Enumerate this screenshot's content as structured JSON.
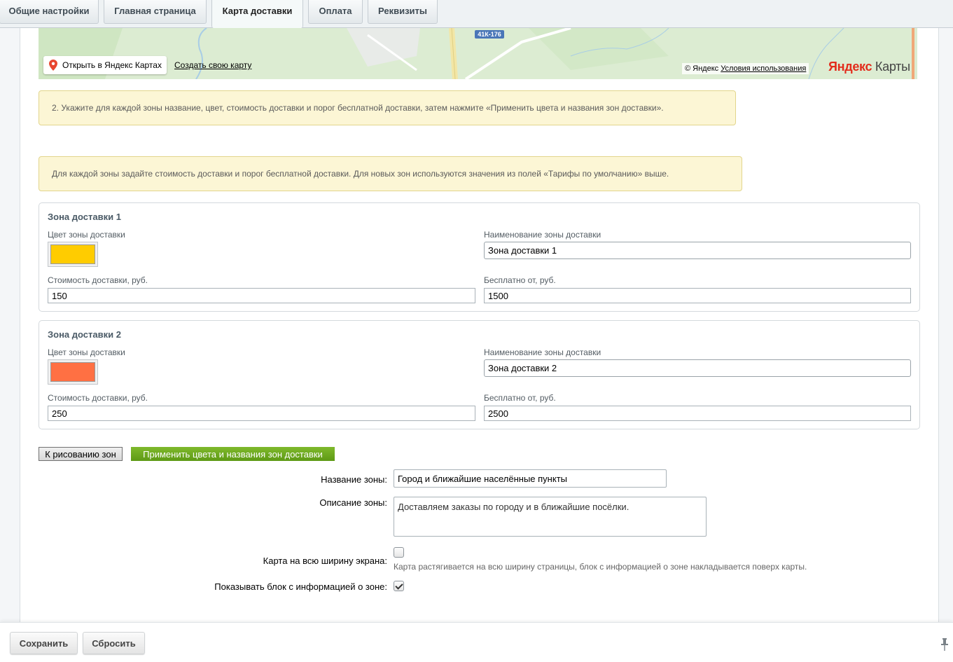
{
  "tabs": [
    {
      "label": "Общие настройки"
    },
    {
      "label": "Главная страница"
    },
    {
      "label": "Карта доставки"
    },
    {
      "label": "Оплата"
    },
    {
      "label": "Реквизиты"
    }
  ],
  "map": {
    "road_badge": "41К-176",
    "open_link": "Открыть в Яндекс Картах",
    "create_link": "Создать свою карту",
    "copyright": "© Яндекс",
    "terms": "Условия использования",
    "logo_part1": "Яндекс",
    "logo_part2": " Карты"
  },
  "notes": {
    "step2": "2. Укажите для каждой зоны название, цвет, стоимость доставки и порог бесплатной доставки, затем нажмите «Применить цвета и названия зон доставки».",
    "defaults": "Для каждой зоны задайте стоимость доставки и порог бесплатной доставки. Для новых зон используются значения из полей «Тарифы по умолчанию» выше."
  },
  "zones": [
    {
      "title": "Зона доставки 1",
      "color_label": "Цвет зоны доставки",
      "color": "#ffcc00",
      "name_label": "Наименование зоны доставки",
      "name": "Зона доставки 1",
      "cost_label": "Стоимость доставки, руб.",
      "cost": "150",
      "free_label": "Бесплатно от, руб.",
      "free": "1500"
    },
    {
      "title": "Зона доставки 2",
      "color_label": "Цвет зоны доставки",
      "color": "#ff7043",
      "name_label": "Наименование зоны доставки",
      "name": "Зона доставки 2",
      "cost_label": "Стоимость доставки, руб.",
      "cost": "250",
      "free_label": "Бесплатно от, руб.",
      "free": "2500"
    }
  ],
  "buttons": {
    "draw": "К рисованию зон",
    "apply": "Применить цвета и названия зон доставки"
  },
  "form": {
    "zone_name_label": "Название зоны:",
    "zone_name": "Город и ближайшие населённые пункты",
    "zone_desc_label": "Описание зоны:",
    "zone_desc": "Доставляем заказы по городу и в ближайшие посёлки.",
    "fullwidth_label": "Карта на всю ширину экрана:",
    "fullwidth_checked": false,
    "fullwidth_hint": "Карта растягивается на всю ширину страницы, блок с информацией о зоне накладывается поверх карты.",
    "showinfo_label": "Показывать блок с информацией о зоне:",
    "showinfo_checked": true
  },
  "footer": {
    "save": "Сохранить",
    "reset": "Сбросить"
  }
}
